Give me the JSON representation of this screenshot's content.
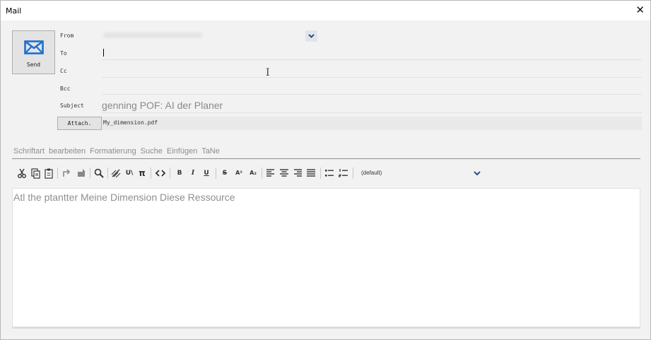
{
  "window": {
    "title": "Mail",
    "close_icon": "close-icon"
  },
  "send_button": {
    "label": "Send",
    "icon": "envelope-icon"
  },
  "fields": {
    "from_label": "From",
    "to_label": "To",
    "cc_label": "Cc",
    "bcc_label": "Bcc",
    "subject_label": "Subject",
    "subject_value": "genning POF: AI der Planer",
    "to_value": "",
    "cc_value": "",
    "bcc_value": ""
  },
  "attach": {
    "button_label": "Attach.",
    "file_name": "My_dimension.pdf"
  },
  "menu": {
    "items": [
      "Schriftart",
      "bearbeiten",
      "Formatierung",
      "Suche",
      "Einfügen",
      "TaNe"
    ]
  },
  "toolbar": {
    "buttons": [
      "cut-icon",
      "copy-icon",
      "paste-icon",
      "undo-icon",
      "redo-icon",
      "find-icon",
      "link-icon",
      "special-chars-icon",
      "math-pi-icon",
      "source-code-icon",
      "bold",
      "italic",
      "underline",
      "strikethrough",
      "superscript",
      "subscript",
      "align-left-icon",
      "align-center-icon",
      "align-right-icon",
      "justify-icon",
      "bulleted-list-icon",
      "numbered-list-icon"
    ],
    "bold_label": "B",
    "italic_label": "I",
    "underline_label": "U",
    "strike_label": "S",
    "superscript_label": "A²",
    "subscript_label": "A₂",
    "unicode_label": "U\\",
    "pi_label": "π",
    "font_select": "(default)"
  },
  "editor": {
    "body_text": "Atl the ptantter Meine Dimension Diese Ressource"
  },
  "colors": {
    "accent": "#1d6fd1",
    "background": "#f2f2f2",
    "chevron": "#2a4f86"
  }
}
